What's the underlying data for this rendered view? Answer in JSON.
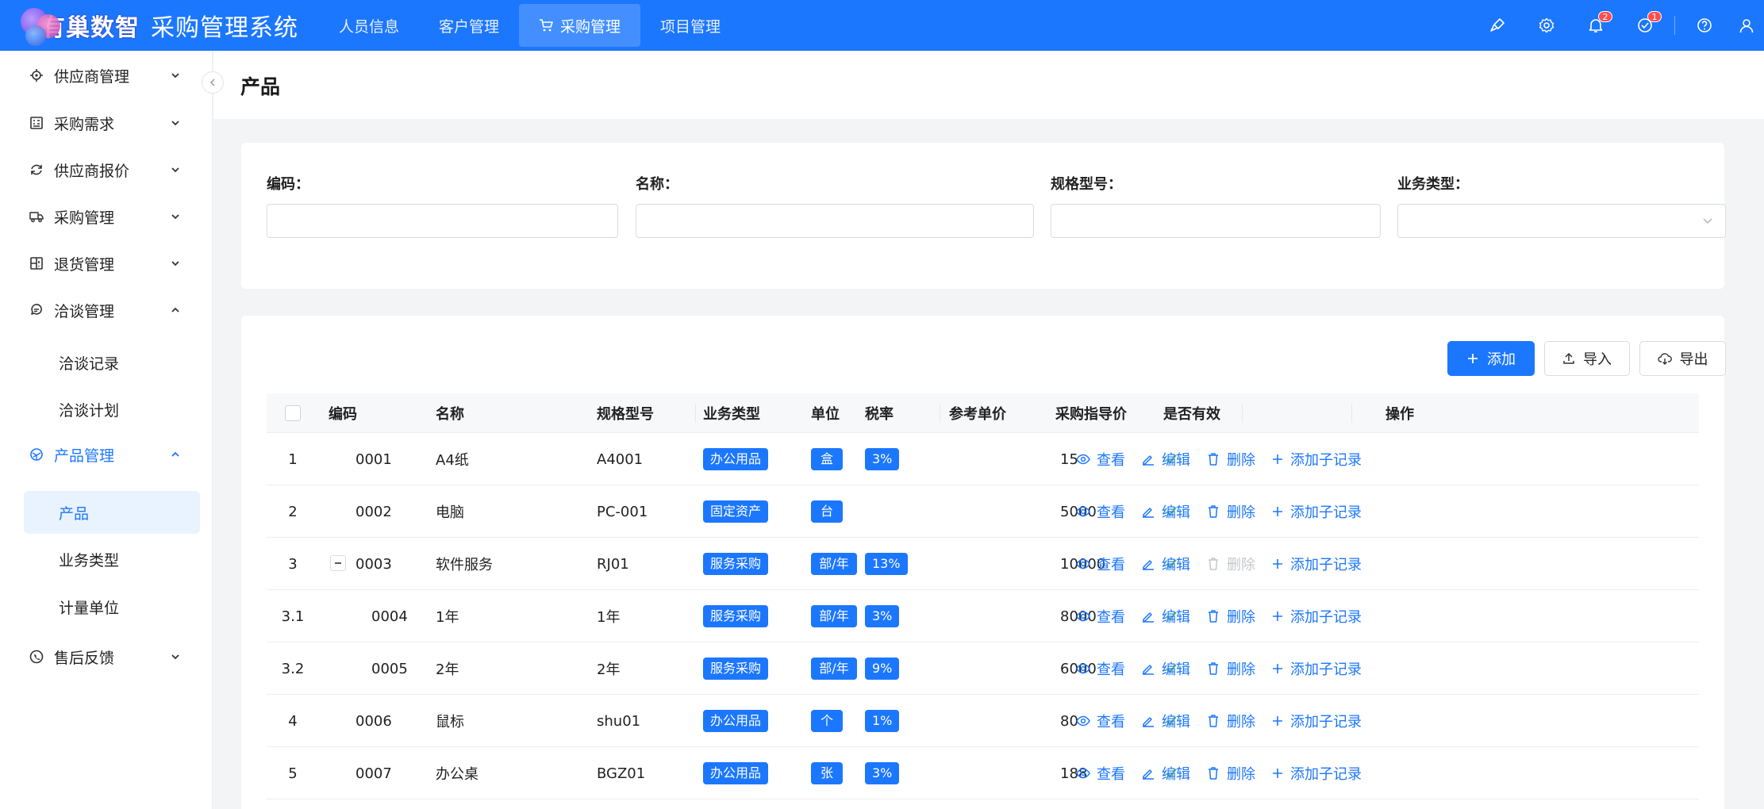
{
  "header": {
    "logo_text": "有巢数智",
    "system_title": "采购管理系统",
    "nav": [
      {
        "label": "人员信息",
        "active": false
      },
      {
        "label": "客户管理",
        "active": false
      },
      {
        "label": "采购管理",
        "active": true
      },
      {
        "label": "项目管理",
        "active": false
      }
    ],
    "icons": [
      "clean-icon",
      "gear-icon",
      "bell-icon",
      "check-circle-icon",
      "help-icon",
      "user-icon"
    ],
    "notification_badge": "2",
    "todo_badge": "1",
    "color": "#1c77ff"
  },
  "sidebar": {
    "items": [
      {
        "label": "供应商管理",
        "icon": "target-icon",
        "expanded": false
      },
      {
        "label": "采购需求",
        "icon": "grid-icon",
        "expanded": false
      },
      {
        "label": "供应商报价",
        "icon": "refresh-icon",
        "expanded": false
      },
      {
        "label": "采购管理",
        "icon": "truck-icon",
        "expanded": false
      },
      {
        "label": "退货管理",
        "icon": "layout-icon",
        "expanded": false
      },
      {
        "label": "洽谈管理",
        "icon": "chat-icon",
        "expanded": true,
        "children": [
          "洽谈记录",
          "洽谈计划"
        ]
      },
      {
        "label": "产品管理",
        "icon": "product-icon",
        "expanded": true,
        "children": [
          "产品",
          "业务类型",
          "计量单位"
        ],
        "active_child": "产品"
      },
      {
        "label": "售后反馈",
        "icon": "phone-icon",
        "expanded": false
      }
    ]
  },
  "page": {
    "title": "产品"
  },
  "filters": {
    "code_label": "编码：",
    "name_label": "名称：",
    "spec_label": "规格型号：",
    "biz_label": "业务类型：",
    "code_value": "",
    "name_value": "",
    "spec_value": "",
    "biz_value": ""
  },
  "toolbar": {
    "add": "添加",
    "import": "导入",
    "export": "导出"
  },
  "table": {
    "columns": [
      "编码",
      "名称",
      "规格型号",
      "业务类型",
      "单位",
      "税率",
      "参考单价",
      "采购指导价",
      "是否有效",
      "操作"
    ],
    "actions": {
      "view": "查看",
      "edit": "编辑",
      "delete": "删除",
      "add_child": "添加子记录"
    },
    "rows": [
      {
        "index": "1",
        "code": "0001",
        "name": "A4纸",
        "spec": "A4001",
        "biz": "办公用品",
        "unit": "盒",
        "tax": "3%",
        "ref_price": "",
        "guide_price": "15",
        "valid": true,
        "delete_disabled": false,
        "child": false,
        "expandable": false
      },
      {
        "index": "2",
        "code": "0002",
        "name": "电脑",
        "spec": "PC-001",
        "biz": "固定资产",
        "unit": "台",
        "tax": "",
        "ref_price": "",
        "guide_price": "5000",
        "valid": true,
        "delete_disabled": false,
        "child": false,
        "expandable": false
      },
      {
        "index": "3",
        "code": "0003",
        "name": "软件服务",
        "spec": "RJ01",
        "biz": "服务采购",
        "unit": "部/年",
        "tax": "13%",
        "ref_price": "",
        "guide_price": "10000",
        "valid": true,
        "delete_disabled": true,
        "child": false,
        "expandable": true
      },
      {
        "index": "3.1",
        "code": "0004",
        "name": "1年",
        "spec": "1年",
        "biz": "服务采购",
        "unit": "部/年",
        "tax": "3%",
        "ref_price": "",
        "guide_price": "8000",
        "valid": true,
        "delete_disabled": false,
        "child": true,
        "expandable": false
      },
      {
        "index": "3.2",
        "code": "0005",
        "name": "2年",
        "spec": "2年",
        "biz": "服务采购",
        "unit": "部/年",
        "tax": "9%",
        "ref_price": "",
        "guide_price": "6000",
        "valid": true,
        "delete_disabled": false,
        "child": true,
        "expandable": false
      },
      {
        "index": "4",
        "code": "0006",
        "name": "鼠标",
        "spec": "shu01",
        "biz": "办公用品",
        "unit": "个",
        "tax": "1%",
        "ref_price": "",
        "guide_price": "80",
        "valid": true,
        "delete_disabled": false,
        "child": false,
        "expandable": false
      },
      {
        "index": "5",
        "code": "0007",
        "name": "办公桌",
        "spec": "BGZ01",
        "biz": "办公用品",
        "unit": "张",
        "tax": "3%",
        "ref_price": "",
        "guide_price": "188",
        "valid": true,
        "delete_disabled": false,
        "child": false,
        "expandable": false
      }
    ]
  }
}
